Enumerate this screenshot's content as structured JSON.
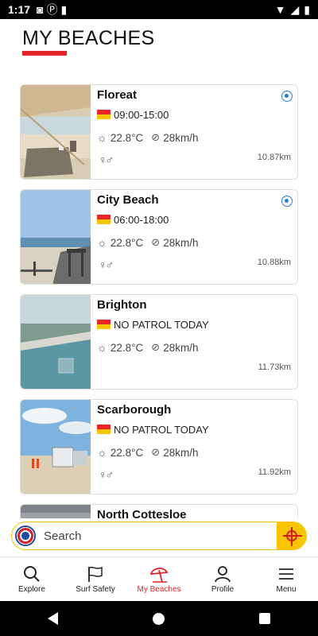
{
  "status_bar": {
    "time": "1:17",
    "icons": [
      "notification-icon",
      "p-icon",
      "sd-card-icon"
    ],
    "right_icons": [
      "wifi-icon",
      "signal-icon",
      "battery-icon"
    ]
  },
  "header": {
    "title": "MY BEACHES"
  },
  "beaches": [
    {
      "name": "Floreat",
      "patrol": "09:00-15:00",
      "temp": "22.8°C",
      "wind": "28km/h",
      "distance": "10.87km",
      "has_facilities": true,
      "has_location_marker": true
    },
    {
      "name": "City Beach",
      "patrol": "06:00-18:00",
      "temp": "22.8°C",
      "wind": "28km/h",
      "distance": "10.88km",
      "has_facilities": true,
      "has_location_marker": true
    },
    {
      "name": "Brighton",
      "patrol": "NO PATROL TODAY",
      "temp": "22.8°C",
      "wind": "28km/h",
      "distance": "11.73km",
      "has_facilities": false,
      "has_location_marker": false
    },
    {
      "name": "Scarborough",
      "patrol": "NO PATROL TODAY",
      "temp": "22.8°C",
      "wind": "28km/h",
      "distance": "11.92km",
      "has_facilities": true,
      "has_location_marker": false
    },
    {
      "name": "North Cottesloe"
    }
  ],
  "search": {
    "placeholder": "Search"
  },
  "bottom_nav": {
    "items": [
      {
        "label": "Explore",
        "icon": "search-icon"
      },
      {
        "label": "Surf Safety",
        "icon": "flag-icon"
      },
      {
        "label": "My Beaches",
        "icon": "umbrella-icon",
        "active": true
      },
      {
        "label": "Profile",
        "icon": "person-icon"
      },
      {
        "label": "Menu",
        "icon": "hamburger-icon"
      }
    ]
  },
  "colors": {
    "accent_red": "#e8232a",
    "flag_yellow": "#f7c600",
    "location_blue": "#2a7bd4"
  }
}
